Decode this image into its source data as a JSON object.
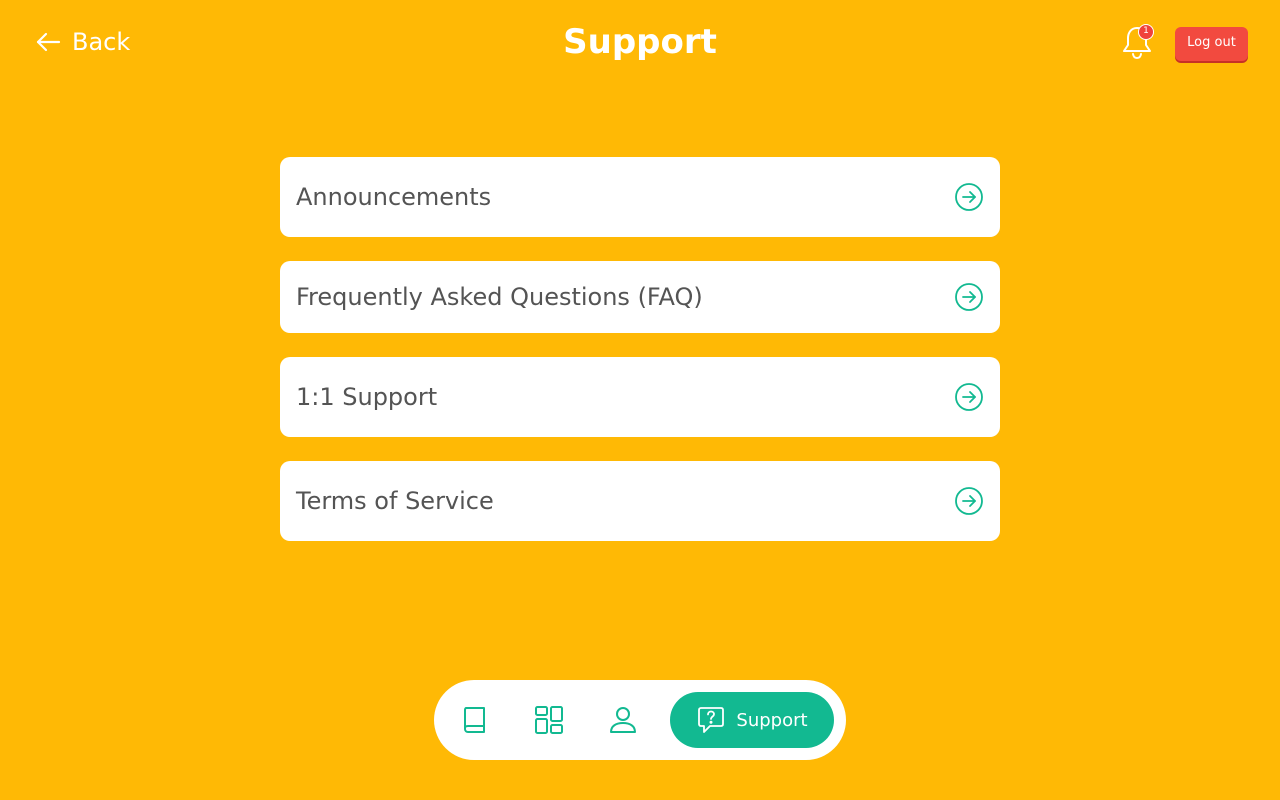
{
  "header": {
    "back_label": "Back",
    "title": "Support",
    "notification_count": "1",
    "logout_label": "Log out"
  },
  "menu": {
    "items": [
      {
        "label": "Announcements"
      },
      {
        "label": "Frequently Asked Questions (FAQ)"
      },
      {
        "label": "1:1 Support"
      },
      {
        "label": "Terms of Service"
      }
    ]
  },
  "bottom_nav": {
    "items": [
      {
        "icon": "book-icon"
      },
      {
        "icon": "dashboard-icon"
      },
      {
        "icon": "user-icon"
      },
      {
        "icon": "help-chat-icon",
        "label": "Support",
        "active": true
      }
    ]
  },
  "colors": {
    "background": "#FFB905",
    "accent": "#12B991",
    "logout": "#F24A3F",
    "text": "#545454"
  }
}
